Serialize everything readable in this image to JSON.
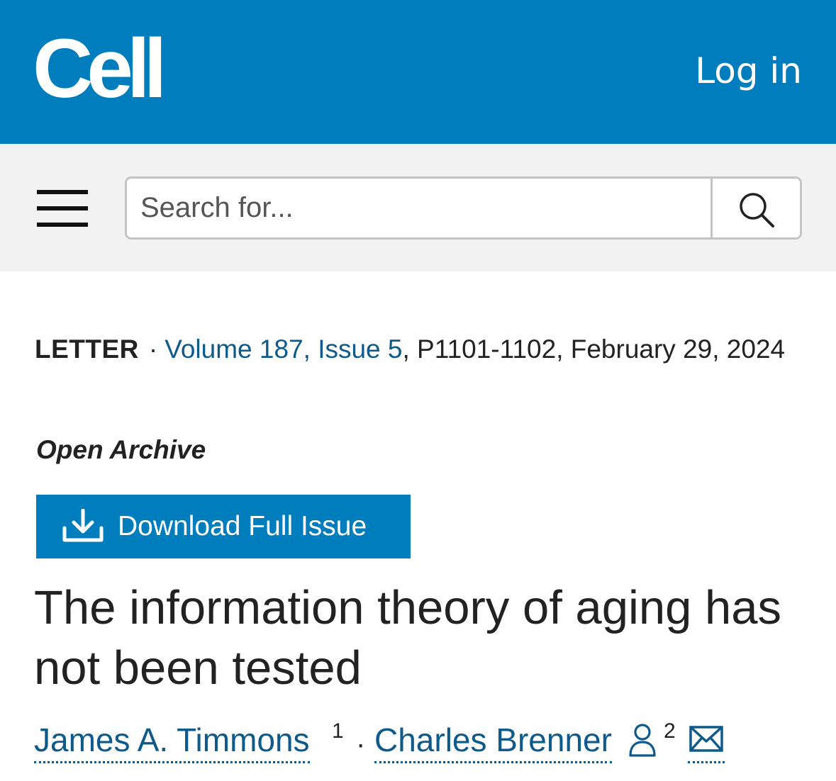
{
  "header": {
    "logo": "Cell",
    "login_label": "Log in"
  },
  "search": {
    "placeholder": "Search for...",
    "button_icon": "search-icon",
    "menu_icon": "hamburger-menu-icon"
  },
  "article": {
    "type": "LETTER",
    "separator": "·",
    "volume_issue": "Volume 187, Issue 5",
    "pages_date": ", P1101-1102, February 29, 2024",
    "access": "Open Archive",
    "download_label": "Download Full Issue",
    "download_icon": "download-icon",
    "title": "The information theory of aging has not been tested"
  },
  "authors": [
    {
      "name": "James A. Timmons",
      "affiliation": "1"
    },
    {
      "name": "Charles Brenner",
      "affiliation": "2",
      "icon": "person-icon",
      "contact_icon": "mail-icon"
    }
  ],
  "colors": {
    "brand_blue": "#007dbc",
    "link_blue": "#0e5a8a",
    "search_bg": "#f2f2f2",
    "text": "#222222"
  }
}
